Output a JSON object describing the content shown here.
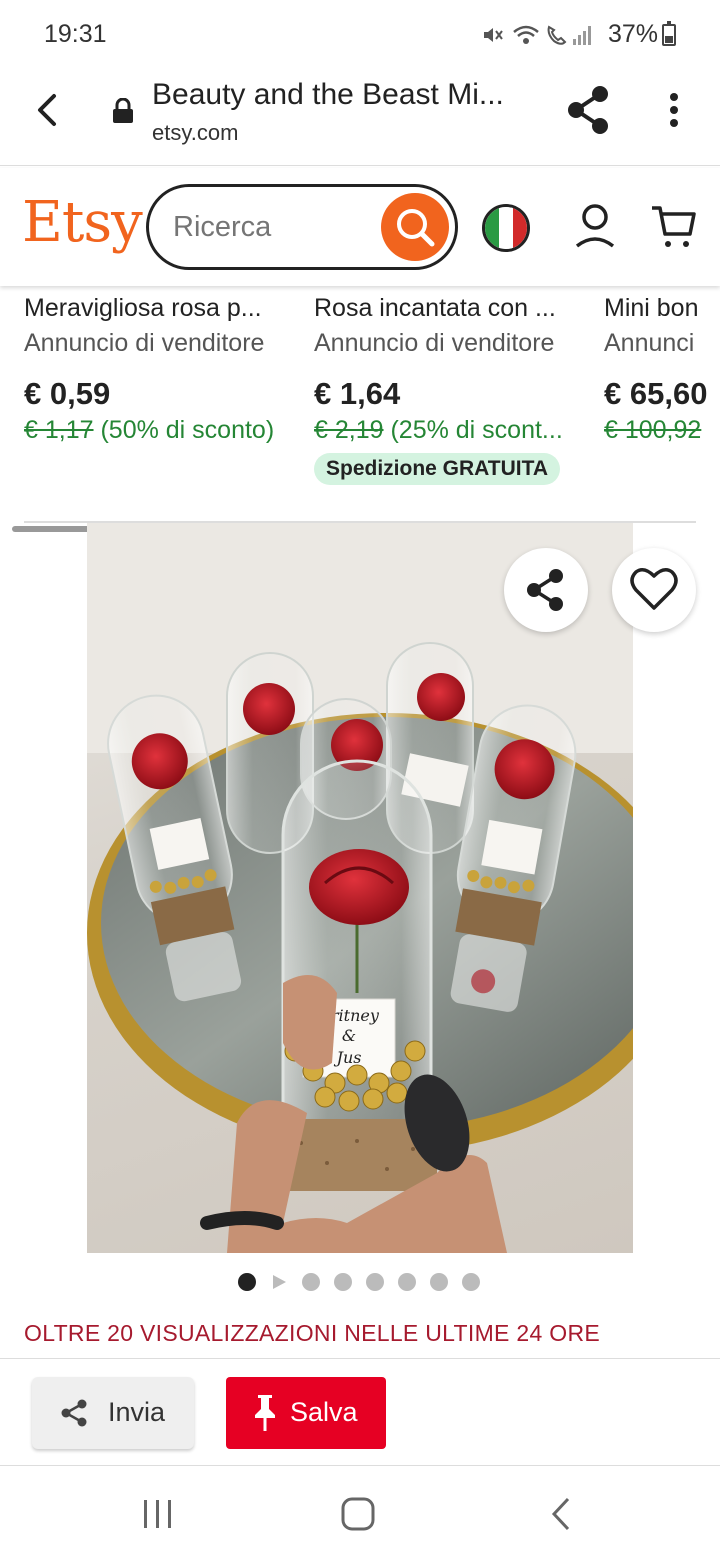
{
  "status": {
    "time": "19:31",
    "battery": "37%"
  },
  "browser": {
    "title": "Beauty and the Beast Mi...",
    "domain": "etsy.com"
  },
  "etsy": {
    "logo": "Etsy",
    "search_placeholder": "Ricerca"
  },
  "listings": [
    {
      "title": "Meravigliosa rosa p...",
      "seller": "Annuncio di venditore",
      "price": "€ 0,59",
      "old_price": "€ 1,17",
      "discount": "(50% di sconto)"
    },
    {
      "title": "Rosa incantata con ...",
      "seller": "Annuncio di venditore",
      "price": "€ 1,64",
      "old_price": "€ 2,19",
      "discount": "(25% di scont...",
      "badge": "Spedizione GRATUITA"
    },
    {
      "title": "Mini bon",
      "seller": "Annunci",
      "price": "€ 65,60",
      "old_price": "€ 100,92",
      "discount": ""
    }
  ],
  "gallery": {
    "image_count": 8,
    "active_index": 0,
    "card_text": "Britney & Jus"
  },
  "views_banner": "OLTRE 20 VISUALIZZAZIONI NELLE ULTIME 24 ORE",
  "share_bar": {
    "send_label": "Invia",
    "save_label": "Salva"
  },
  "colors": {
    "etsy_orange": "#f1641e",
    "discount_green": "#258635",
    "pinterest_red": "#e60023",
    "banner_red": "#a61a2e"
  }
}
